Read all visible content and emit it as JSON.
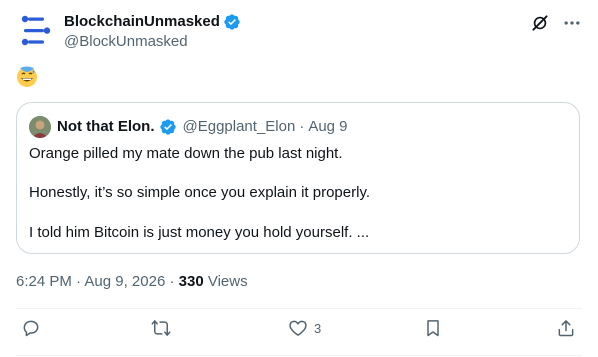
{
  "author": {
    "display_name": "BlockchainUnmasked",
    "handle": "@BlockUnmasked",
    "verified_icon": "verified-badge-icon"
  },
  "post": {
    "emoji": "😅"
  },
  "quoted_post": {
    "display_name": "Not that Elon.",
    "handle": "@Eggplant_Elon",
    "separator": "·",
    "date": "Aug 9",
    "lines": [
      "Orange pilled my mate down the pub last night.",
      "Honestly, it’s so simple once you explain it properly.",
      "I told him Bitcoin is just money you hold yourself. ..."
    ]
  },
  "meta": {
    "time": "6:24 PM",
    "date": "Aug 9, 2026",
    "views_count": "330",
    "views_label": "Views",
    "sep1": "·",
    "sep2": "·"
  },
  "actions": {
    "likes_count": "3"
  },
  "colors": {
    "brand_blue": "#1d9bf0",
    "muted": "#536471",
    "text": "#0f1419",
    "logo": "#2b5bd7"
  }
}
